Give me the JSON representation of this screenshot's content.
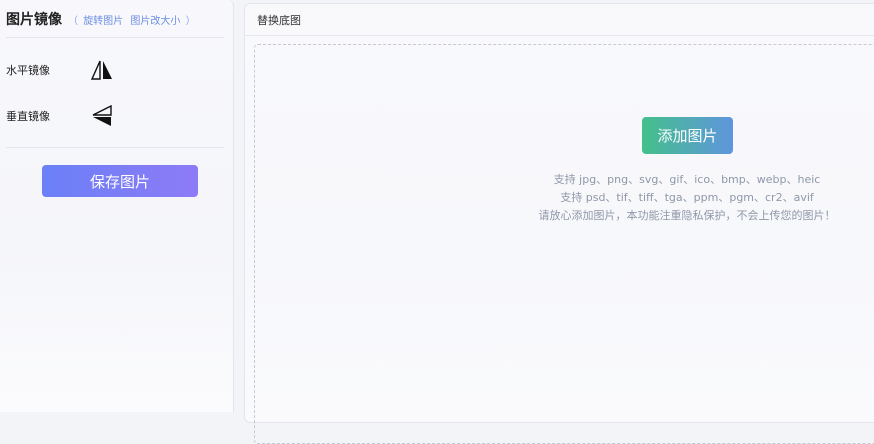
{
  "left": {
    "title": "图片镜像",
    "paren_open": "（",
    "paren_close": "）",
    "links": [
      {
        "label": "旋转图片"
      },
      {
        "label": "图片改大小"
      }
    ],
    "tools": [
      {
        "label": "水平镜像",
        "icon": "flip-horizontal-icon"
      },
      {
        "label": "垂直镜像",
        "icon": "flip-vertical-icon"
      }
    ],
    "save_label": "保存图片"
  },
  "right": {
    "title": "替换底图",
    "add_label": "添加图片",
    "hints": [
      "支持 jpg、png、svg、gif、ico、bmp、webp、heic",
      "支持 psd、tif、tiff、tga、ppm、pgm、cr2、avif",
      "请放心添加图片，本功能注重隐私保护，不会上传您的图片！"
    ]
  },
  "colors": {
    "accent_blue": "#6b8ee0",
    "save_gradient_start": "#6b80f7",
    "save_gradient_end": "#8d7bf6",
    "add_gradient_start": "#44c08a",
    "add_gradient_end": "#5f95de",
    "hint_text": "#8f97a8"
  }
}
